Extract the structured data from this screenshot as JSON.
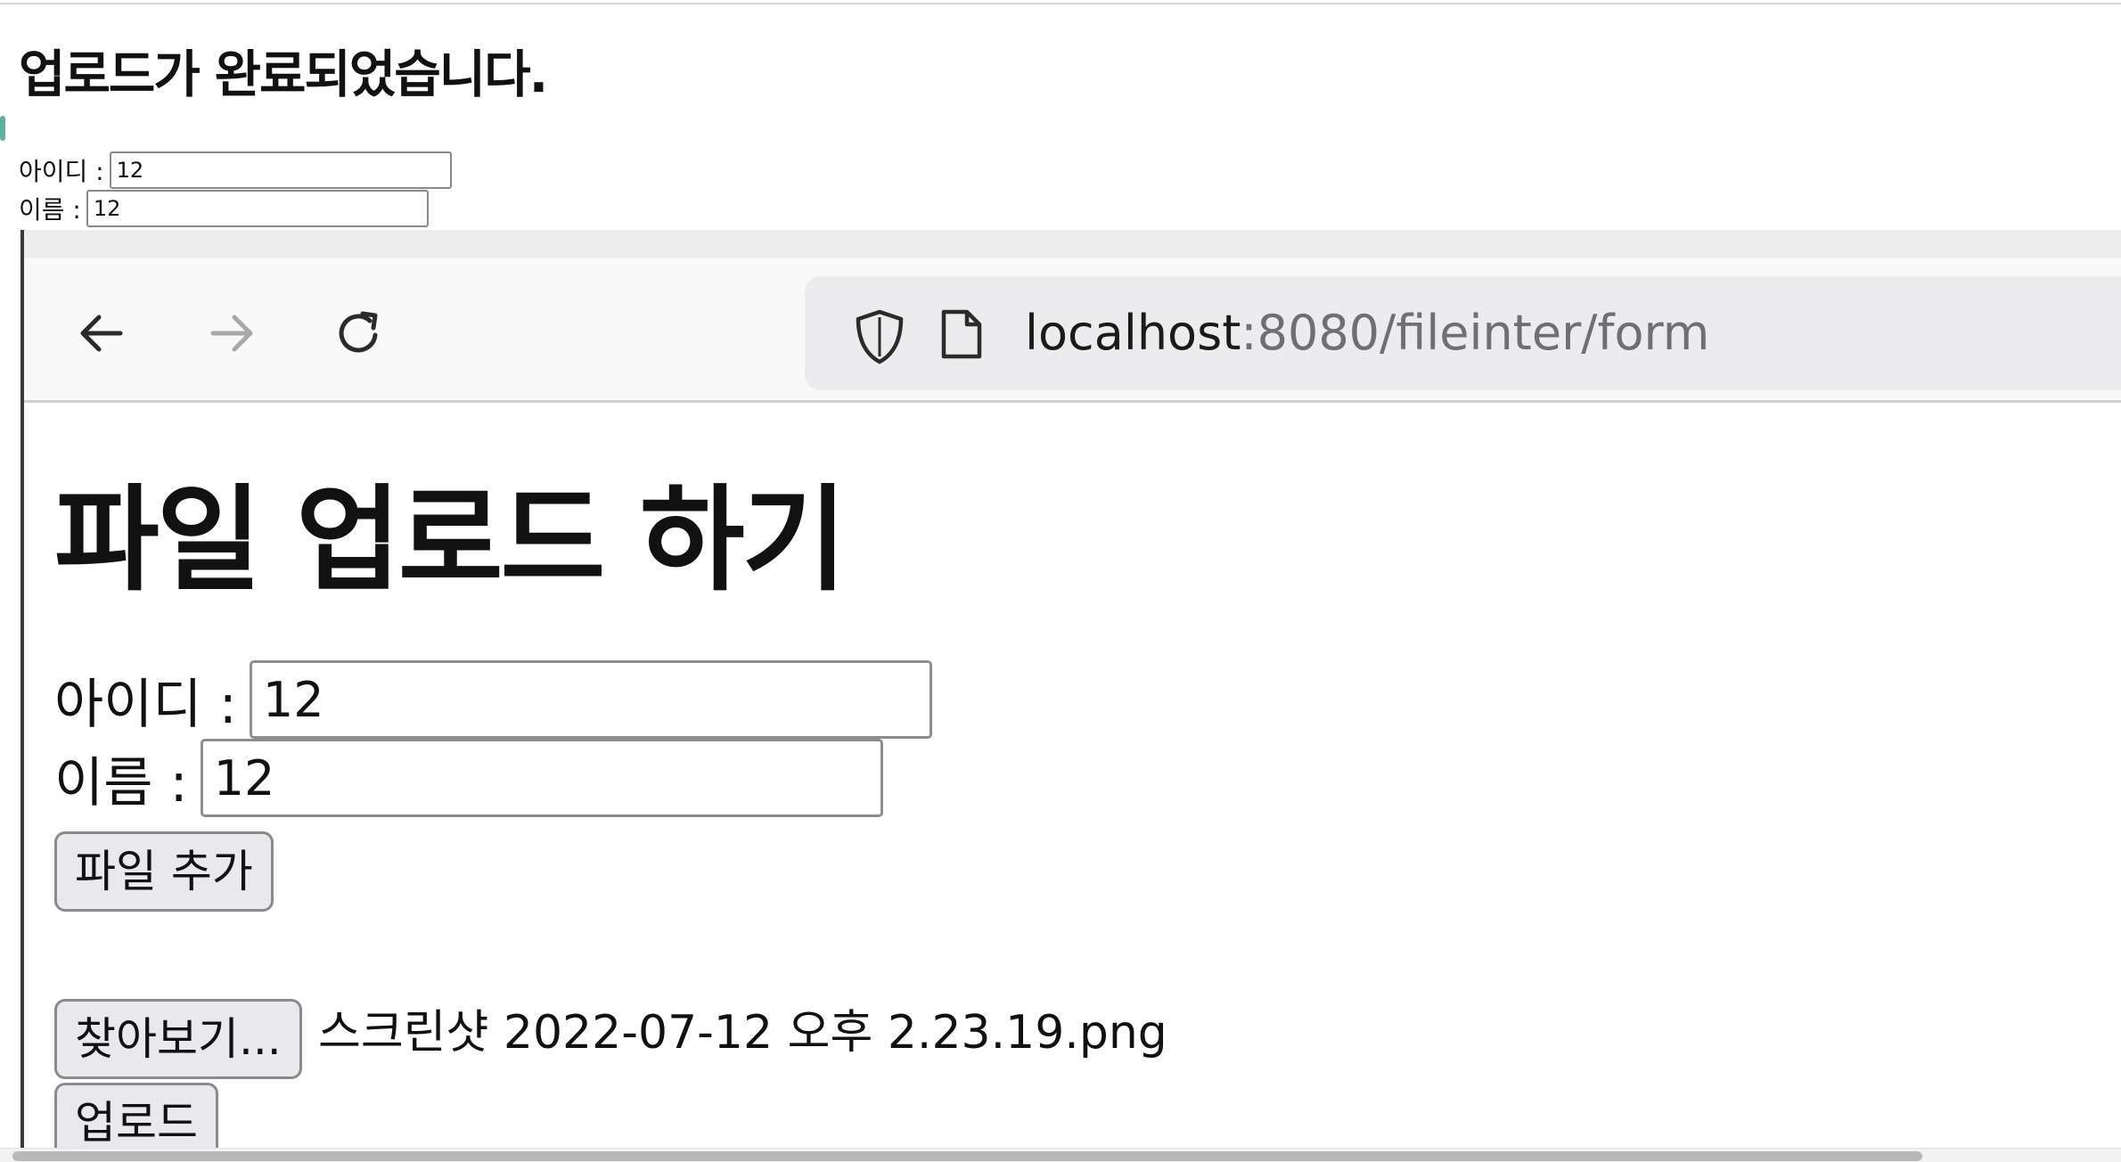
{
  "outer": {
    "title": "업로드가 완료되었습니다.",
    "id_label": "아이디 :",
    "id_value": "12",
    "name_label": "이름 :",
    "name_value": "12"
  },
  "browser": {
    "url_host": "localhost",
    "url_rest": ":8080/fileinter/form",
    "icons": [
      "back-arrow-icon",
      "forward-arrow-icon",
      "reload-icon",
      "shield-icon",
      "page-icon"
    ]
  },
  "form": {
    "title": "파일 업로드 하기",
    "id_label": "아이디 :",
    "id_value": "12",
    "name_label": "이름 :",
    "name_value": "12",
    "add_file_button": "파일 추가",
    "browse_button": "찾아보기...",
    "selected_file": "스크린샷 2022-07-12 오후 2.23.19.png",
    "upload_button": "업로드"
  },
  "colors": {
    "accent": "#5fb0a4",
    "toolbar_bg": "#f9f9fa",
    "urlbar_bg": "#ececee",
    "url_muted": "#6e6e73",
    "button_bg": "#e9e9ed"
  }
}
